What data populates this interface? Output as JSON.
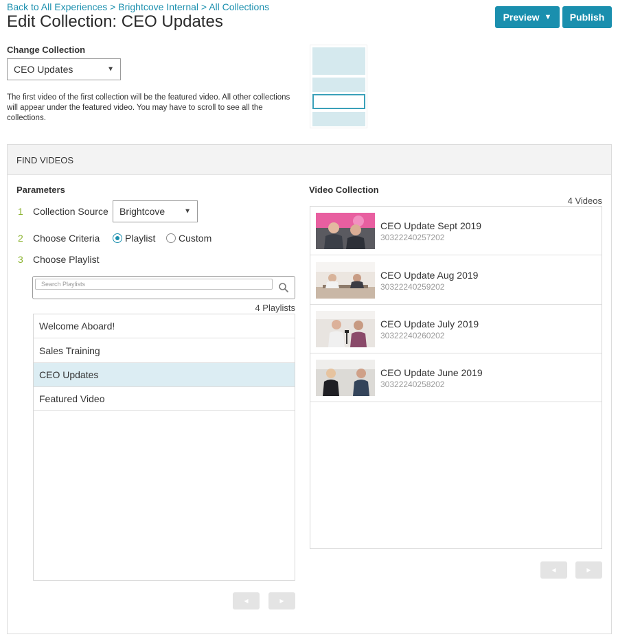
{
  "breadcrumb": {
    "link1": "Back to All Experiences",
    "sep1": " > ",
    "link2": "Brightcove Internal",
    "sep2": " > ",
    "link3": "All Collections"
  },
  "page_title": "Edit Collection: CEO Updates",
  "toolbar": {
    "preview_label": "Preview",
    "preview_caret": "▼",
    "publish_label": "Publish"
  },
  "change_collection": {
    "label": "Change Collection",
    "selected": "CEO Updates",
    "help_text": "The first video of the first collection will be the featured video. All other collections will appear under the featured video. You may have to scroll to see all the collections."
  },
  "find_videos": {
    "title": "FIND VIDEOS",
    "parameters_heading": "Parameters",
    "steps": [
      {
        "num": "1",
        "label": "Collection Source"
      },
      {
        "num": "2",
        "label": "Choose Criteria"
      },
      {
        "num": "3",
        "label": "Choose Playlist"
      }
    ],
    "source_selected": "Brightcove",
    "criteria": {
      "option1": "Playlist",
      "option2": "Custom",
      "selected": "Playlist"
    },
    "search_placeholder": "Search Playlists",
    "playlist_count": "4 Playlists",
    "playlists": [
      {
        "label": "Welcome Aboard!"
      },
      {
        "label": "Sales Training"
      },
      {
        "label": "CEO Updates"
      },
      {
        "label": "Featured Video"
      }
    ],
    "selected_playlist": "CEO Updates"
  },
  "video_collection": {
    "heading": "Video Collection",
    "count": "4 Videos",
    "videos": [
      {
        "title": "CEO Update Sept 2019",
        "id": "30322240257202"
      },
      {
        "title": "CEO Update Aug 2019",
        "id": "30322240259202"
      },
      {
        "title": "CEO Update July 2019",
        "id": "30322240260202"
      },
      {
        "title": "CEO Update June 2019",
        "id": "30322240258202"
      }
    ]
  },
  "pager": {
    "prev": "◀",
    "next": "▶"
  },
  "colors": {
    "accent": "#1a8fae",
    "step_number": "#8cb431",
    "selected_row": "#dcedf3"
  }
}
